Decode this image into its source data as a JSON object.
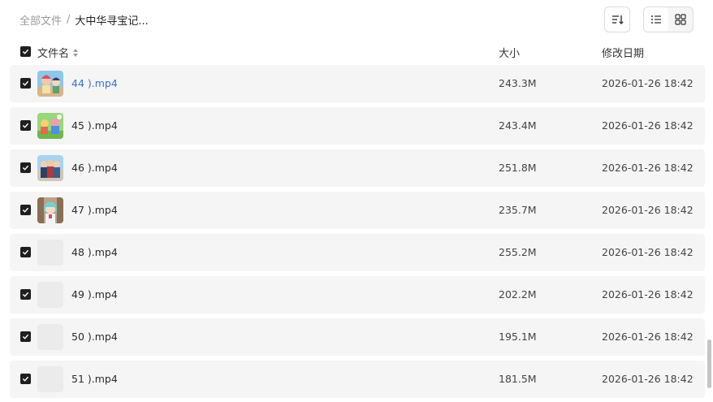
{
  "breadcrumb": {
    "root": "全部文件",
    "separator": "/",
    "current": "大中华寻宝记..."
  },
  "toolbar": {
    "sort_icon": "sort-icon",
    "list_view_icon": "list-view-icon",
    "grid_view_icon": "grid-view-icon",
    "active_view": "list"
  },
  "columns": {
    "name": "文件名",
    "size": "大小",
    "modified": "修改日期"
  },
  "files": [
    {
      "name": "44 ).mp4",
      "size": "243.3M",
      "date": "2026-01-26 18:42",
      "thumb": "video-thumbnail",
      "selected": true
    },
    {
      "name": "45 ).mp4",
      "size": "243.4M",
      "date": "2026-01-26 18:42",
      "thumb": "video-thumbnail",
      "selected": true
    },
    {
      "name": "46 ).mp4",
      "size": "251.8M",
      "date": "2026-01-26 18:42",
      "thumb": "video-thumbnail",
      "selected": true
    },
    {
      "name": "47 ).mp4",
      "size": "235.7M",
      "date": "2026-01-26 18:42",
      "thumb": "video-thumbnail",
      "selected": true
    },
    {
      "name": "48 ).mp4",
      "size": "255.2M",
      "date": "2026-01-26 18:42",
      "thumb": "placeholder",
      "selected": true
    },
    {
      "name": "49 ).mp4",
      "size": "202.2M",
      "date": "2026-01-26 18:42",
      "thumb": "placeholder",
      "selected": true
    },
    {
      "name": "50 ).mp4",
      "size": "195.1M",
      "date": "2026-01-26 18:42",
      "thumb": "placeholder",
      "selected": true
    },
    {
      "name": "51 ).mp4",
      "size": "181.5M",
      "date": "2026-01-26 18:42",
      "thumb": "placeholder",
      "selected": true
    }
  ],
  "colors": {
    "link": "#3b6fd4",
    "row_bg": "#f5f5f5",
    "checkbox": "#1f1f1f"
  }
}
